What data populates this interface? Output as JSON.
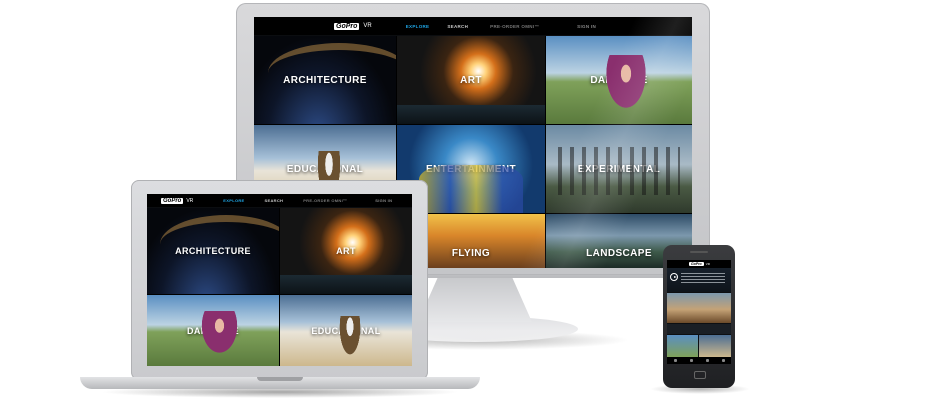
{
  "brand": {
    "logo": "GoPro",
    "product": "VR"
  },
  "nav": {
    "explore": "EXPLORE",
    "search": "SEARCH",
    "rig": "PRE-ORDER OMNI™",
    "signin": "SIGN IN",
    "accent_color": "#1fa6e6"
  },
  "monitor": {
    "categories": [
      "ARCHITECTURE",
      "ART",
      "DAILY LIFE",
      "EDUCATIONAL",
      "ENTERTAINMENT",
      "EXPERIMENTAL",
      "",
      "FLYING",
      "LANDSCAPE"
    ]
  },
  "laptop": {
    "categories": [
      "ARCHITECTURE",
      "ART",
      "DAILY LIFE",
      "EDUCATIONAL"
    ]
  },
  "phone": {
    "title_lines": "VR"
  }
}
